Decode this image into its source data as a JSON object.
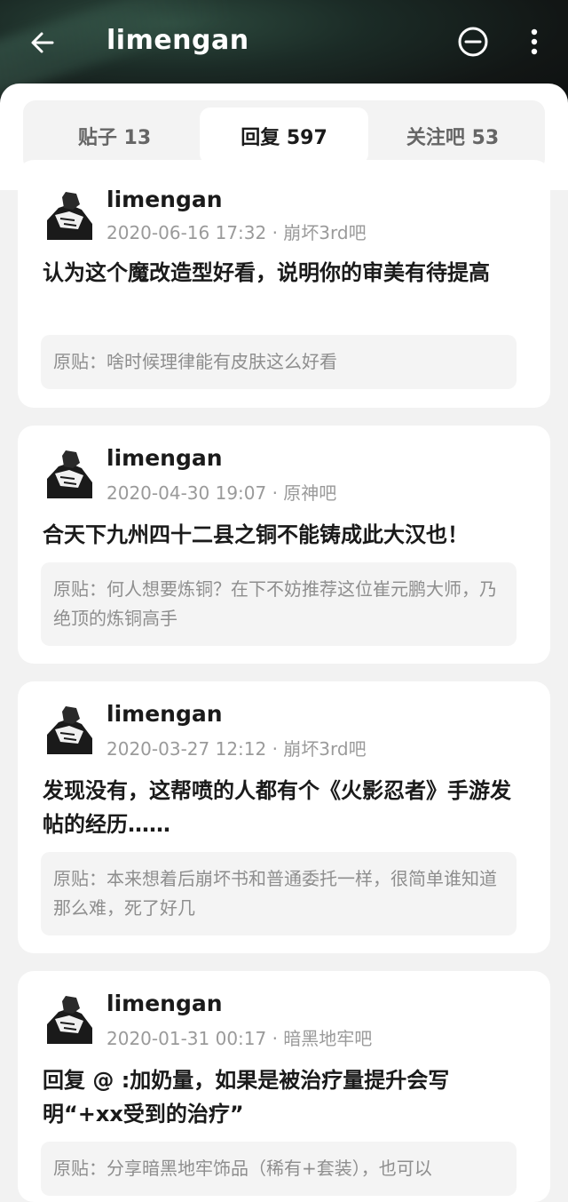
{
  "header": {
    "title": "limengan",
    "back_icon": "arrow-left-icon",
    "block_icon": "minus-circle-icon",
    "more_icon": "more-vertical-icon"
  },
  "tabs": [
    {
      "label": "贴子 13",
      "active": false
    },
    {
      "label": "回复 597",
      "active": true
    },
    {
      "label": "关注吧 53",
      "active": false
    }
  ],
  "replies": [
    {
      "username": "limengan",
      "meta": "2020-06-16 17:32 · 崩坏3rd吧",
      "content": "认为这个魔改造型好看，说明你的审美有待提高",
      "quote": "原贴：啥时候理律能有皮肤这么好看"
    },
    {
      "username": "limengan",
      "meta": "2020-04-30 19:07 · 原神吧",
      "content": "合天下九州四十二县之铜不能铸成此大汉也！",
      "quote": "原贴：何人想要炼铜？在下不妨推荐这位崔元鹏大师，乃绝顶的炼铜高手"
    },
    {
      "username": "limengan",
      "meta": "2020-03-27 12:12 · 崩坏3rd吧",
      "content": "发现没有，这帮喷的人都有个《火影忍者》手游发帖的经历……",
      "quote": "原贴：本来想着后崩坏书和普通委托一样，很简单谁知道那么难，死了好几"
    },
    {
      "username": "limengan",
      "meta": "2020-01-31 00:17 · 暗黑地牢吧",
      "content": "回复 @ :加奶量，如果是被治疗量提升会写明“+xx受到的治疗”",
      "quote": "原贴：分享暗黑地牢饰品（稀有+套装），也可以"
    }
  ],
  "colors": {
    "header_bg": "#121615",
    "accent_text": "#1a1a1a",
    "muted_text": "#9a9a9a",
    "page_bg": "#f2f2f2"
  }
}
